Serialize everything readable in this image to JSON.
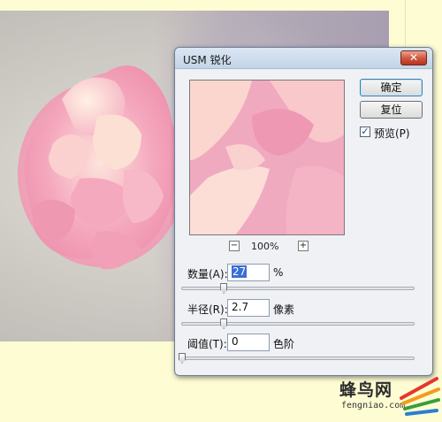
{
  "dialog": {
    "title": "USM 锐化",
    "close_label": "✕",
    "ok_label": "确定",
    "reset_label": "复位",
    "preview_checked": true,
    "preview_check_glyph": "✓",
    "preview_label": "预览(P)",
    "zoom_level": "100%",
    "zoom_out_label": "−",
    "zoom_in_label": "+",
    "amount": {
      "label": "数量(A):",
      "value": "27",
      "unit": "%",
      "slider_fraction": 0.18
    },
    "radius": {
      "label": "半径(R):",
      "value": "2.7",
      "unit": "像素",
      "slider_fraction": 0.18
    },
    "threshold": {
      "label": "阈值(T):",
      "value": "0",
      "unit": "色阶",
      "slider_fraction": 0.0
    }
  },
  "watermark": {
    "text": "蜂鸟网",
    "subtext": "fengniao.com"
  },
  "colors": {
    "background": "#fdfcd3",
    "dialog_bg": "#eff1f4",
    "title_bar": "#c4d4e8",
    "close_button": "#d05a40",
    "flower_pink": "#f2a6bd"
  }
}
